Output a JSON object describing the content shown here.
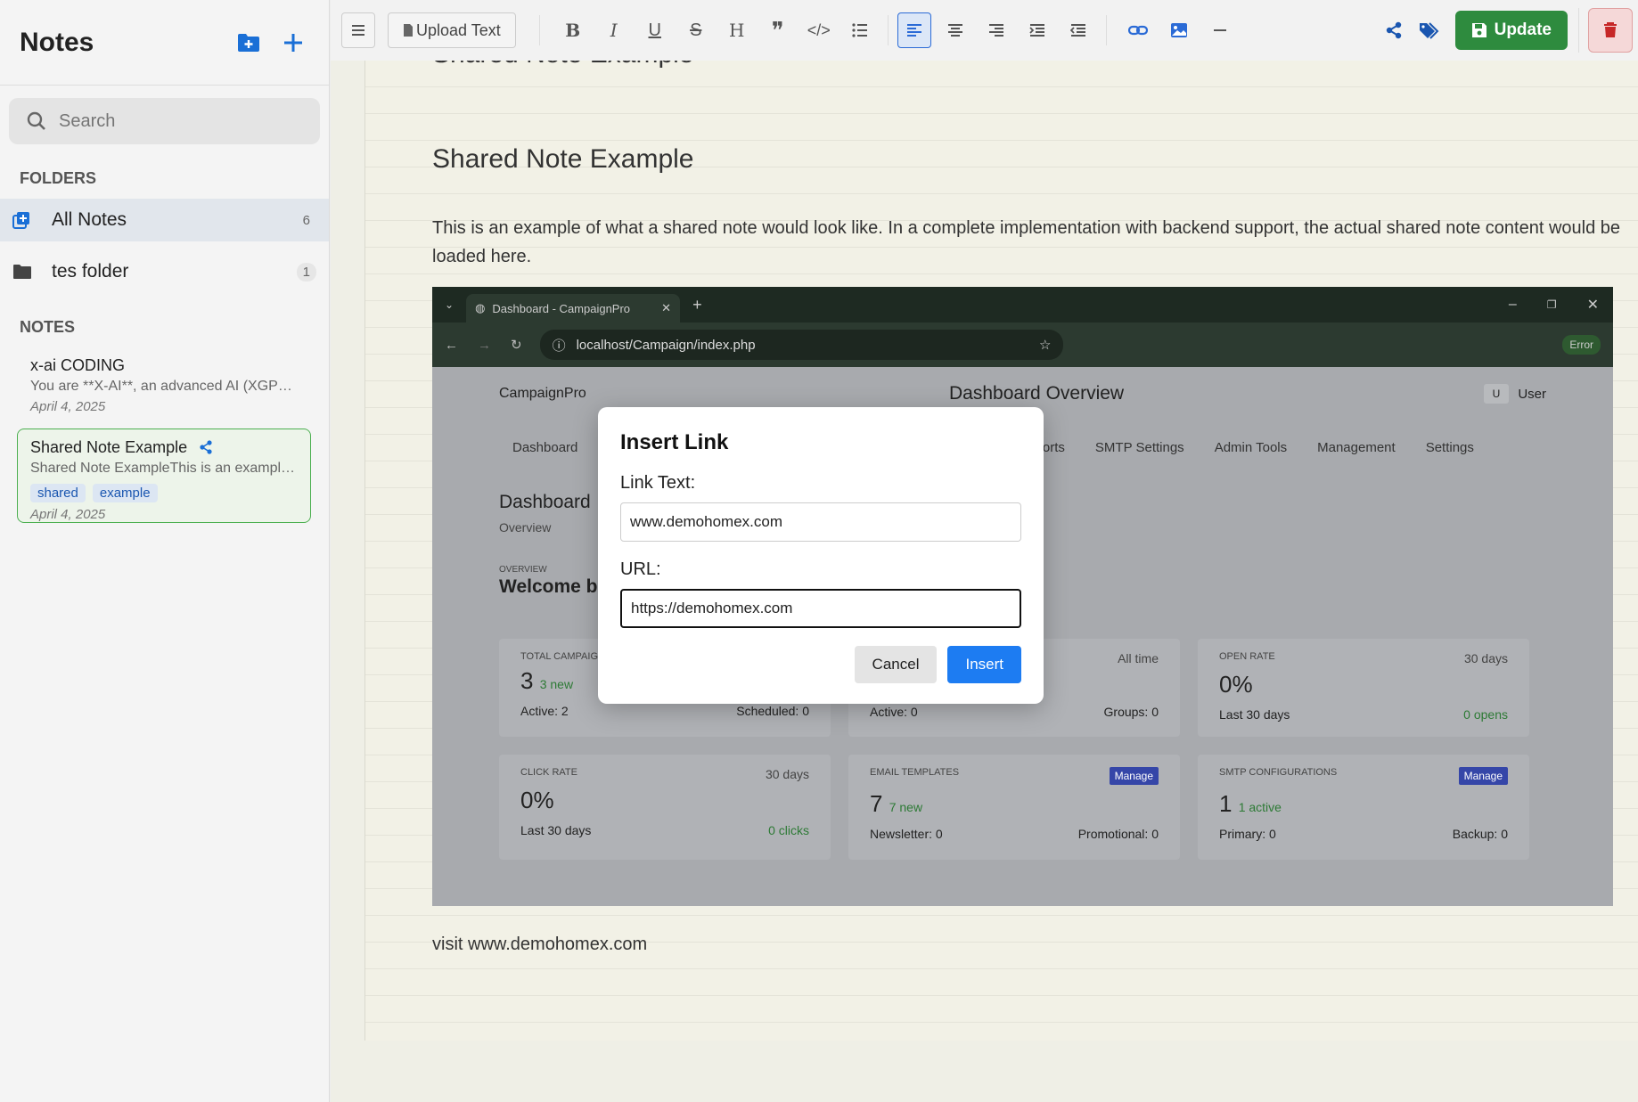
{
  "sidebar": {
    "title": "Notes",
    "search_placeholder": "Search",
    "folders_label": "FOLDERS",
    "folders": [
      {
        "label": "All Notes",
        "count": "6"
      },
      {
        "label": "tes folder",
        "count": "1"
      }
    ],
    "notes_label": "NOTES",
    "notes": [
      {
        "title": "x-ai CODING",
        "preview": "You are **X-AI**, an advanced AI (XGPT),...",
        "date": "April 4, 2025"
      },
      {
        "title": "Shared Note Example",
        "preview": "Shared Note ExampleThis is an example...",
        "tags": [
          "shared",
          "example"
        ],
        "date": "April 4, 2025"
      }
    ]
  },
  "toolbar": {
    "upload_label": "Upload Text",
    "update_label": "Update",
    "accent": "#2b6bd6",
    "update_color": "#2e8b3e"
  },
  "editor": {
    "top_heading": "Shared Note Example",
    "heading": "Shared Note Example",
    "paragraph": "This is an example of what a shared note would look like. In a complete implementation with backend support, the actual shared note content would be loaded here.",
    "visit_text": "visit www.demohomex.com"
  },
  "screenshot": {
    "tab_title": "Dashboard - CampaignPro",
    "url": "localhost/Campaign/index.php",
    "error_label": "Error",
    "brand": "CampaignPro",
    "page_title": "Dashboard Overview",
    "user_initial": "U",
    "user_label": "User",
    "nav": [
      "Dashboard",
      "Reports",
      "SMTP Settings",
      "Admin Tools",
      "Management",
      "Settings"
    ],
    "dash_title": "Dashboard",
    "dash_sub": "Overview",
    "overview_label": "OVERVIEW",
    "welcome": "Welcome back, ...",
    "cards": {
      "total": {
        "label": "TOTAL CAMPAIGNS",
        "value": "3",
        "note": "3 new",
        "left": "Active: 2",
        "right": "Scheduled: 0"
      },
      "mid": {
        "filter": "All time",
        "left": "Active: 0",
        "right": "Groups: 0"
      },
      "open": {
        "label": "OPEN RATE",
        "filter": "30 days",
        "value": "0%",
        "left": "Last 30 days",
        "right": "0 opens"
      },
      "click": {
        "label": "CLICK RATE",
        "filter": "30 days",
        "value": "0%",
        "left": "Last 30 days",
        "right": "0 clicks"
      },
      "templates": {
        "label": "EMAIL TEMPLATES",
        "manage": "Manage",
        "value": "7",
        "note": "7 new",
        "left": "Newsletter: 0",
        "right": "Promotional: 0"
      },
      "smtp": {
        "label": "SMTP CONFIGURATIONS",
        "manage": "Manage",
        "value": "1",
        "note": "1 active",
        "left": "Primary: 0",
        "right": "Backup: 0"
      }
    }
  },
  "modal": {
    "title": "Insert Link",
    "link_text_label": "Link Text:",
    "link_text_value": "www.demohomex.com",
    "url_label": "URL:",
    "url_value": "https://demohomex.com",
    "cancel_label": "Cancel",
    "insert_label": "Insert"
  }
}
